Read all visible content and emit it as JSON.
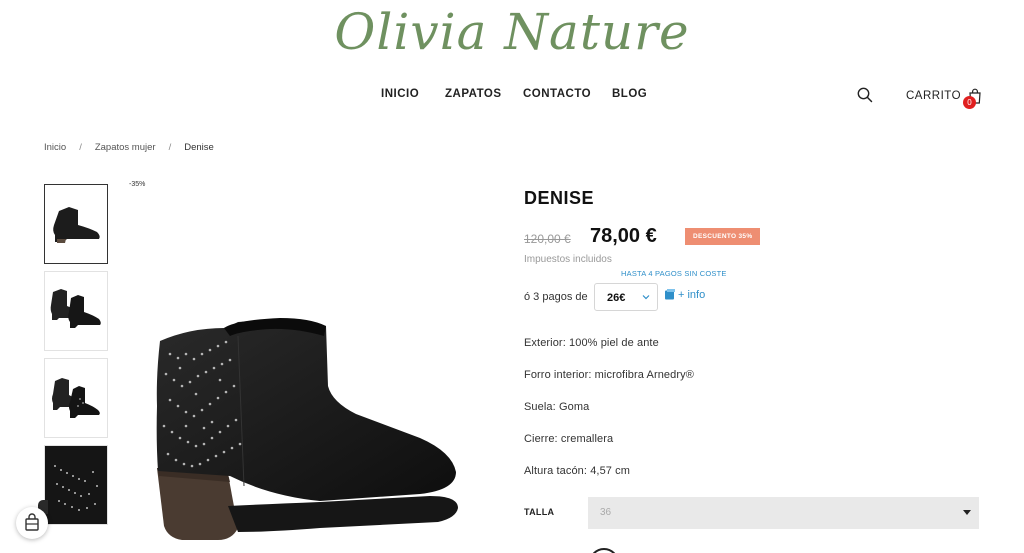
{
  "brand": {
    "logo_text": "Olivia Nature",
    "color": "#6f9160"
  },
  "nav": {
    "items": [
      {
        "label": "INICIO"
      },
      {
        "label": "ZAPATOS"
      },
      {
        "label": "CONTACTO"
      },
      {
        "label": "BLOG"
      }
    ],
    "search_icon": "search-icon",
    "cart_label": "CARRITO",
    "cart_icon": "shopping-bag-icon",
    "cart_count": "0"
  },
  "breadcrumb": {
    "items": [
      {
        "label": "Inicio"
      },
      {
        "label": "Zapatos mujer"
      }
    ],
    "separator": "/",
    "current": "Denise"
  },
  "gallery": {
    "image_discount": "-35%",
    "thumbnails": [
      {
        "view": "side",
        "active": true
      },
      {
        "view": "pair",
        "active": false
      },
      {
        "view": "pair-back",
        "active": false
      },
      {
        "view": "detail",
        "active": false
      }
    ]
  },
  "product": {
    "name": "DENISE",
    "old_price": "120,00 €",
    "price": "78,00 €",
    "discount_badge": "DESCUENTO 35%",
    "tax_note": "Impuestos incluidos",
    "payments": {
      "promo": "HASTA 4 PAGOS SIN COSTE",
      "label": "ó 3 pagos de",
      "selected_amount": "26€",
      "more_info": "+ info"
    },
    "features": [
      "Exterior: 100% piel de ante",
      "Forro interior: microfibra Arnedry®",
      "Suela: Goma",
      "Cierre: cremallera",
      "Altura tacón: 4,57 cm"
    ],
    "size": {
      "label": "TALLA",
      "selected": "36"
    }
  },
  "colors": {
    "accent_blue": "#2f8fc9",
    "badge_salmon": "#ee8e72",
    "cart_badge_red": "#e02020"
  }
}
